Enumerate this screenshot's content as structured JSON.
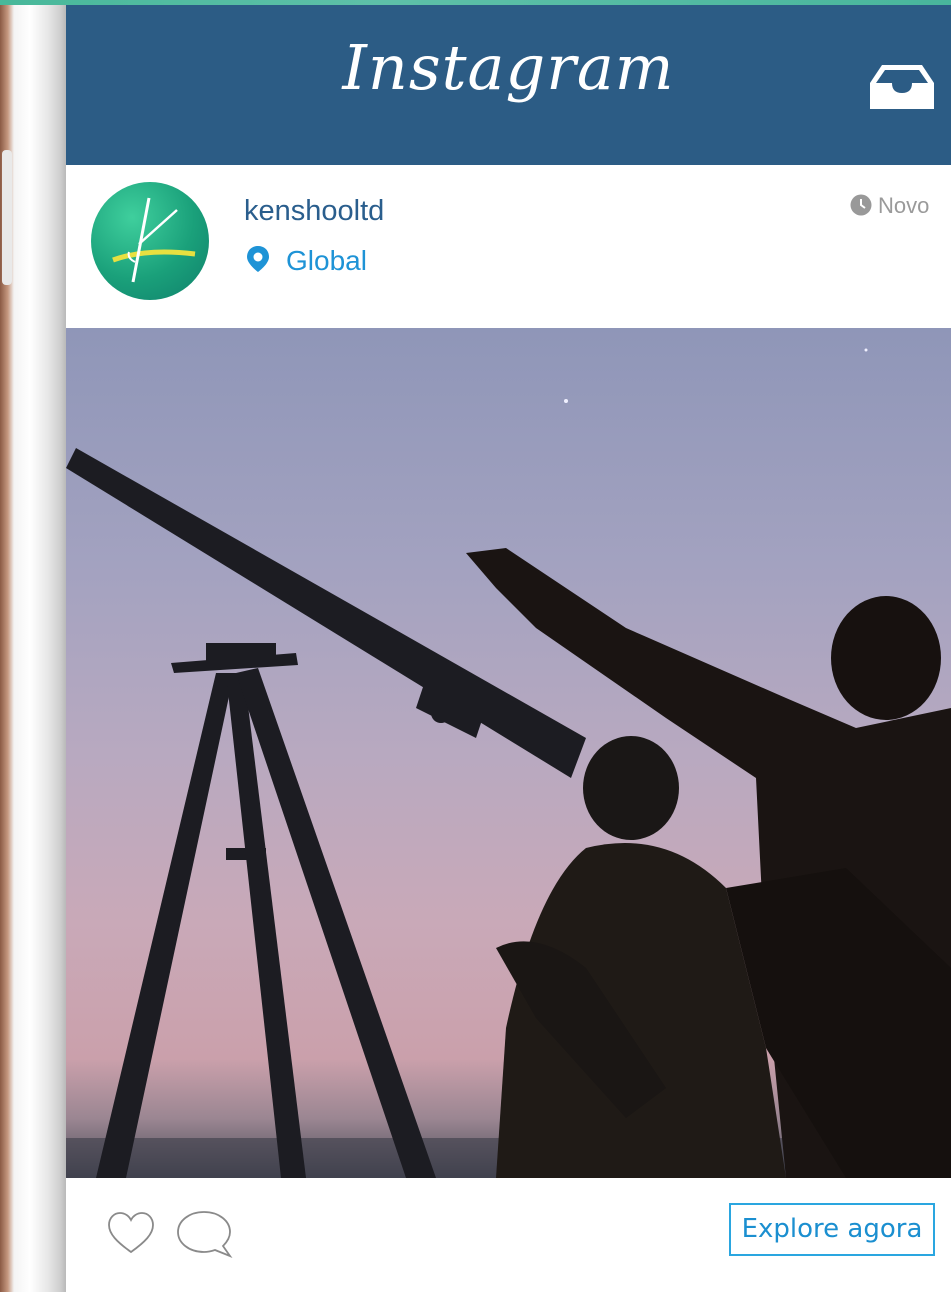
{
  "app": {
    "title": "Instagram"
  },
  "post": {
    "username": "kenshooltd",
    "location": "Global",
    "time_label": "Novo"
  },
  "actions": {
    "explore_label": "Explore agora"
  },
  "icons": {
    "inbox": "inbox-icon",
    "location": "location-pin-icon",
    "clock": "clock-icon",
    "heart": "heart-icon",
    "comment": "comment-icon"
  },
  "colors": {
    "header": "#2c5c85",
    "username": "#2a5e8d",
    "location": "#1e93d6",
    "button_border": "#2aa6e0"
  }
}
